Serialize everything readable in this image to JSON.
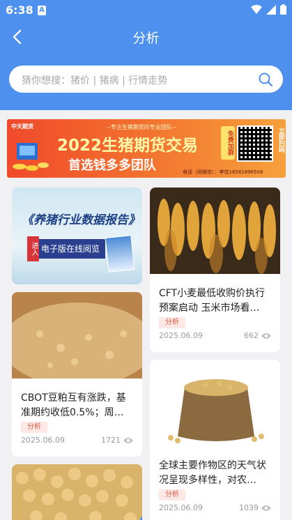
{
  "status_bar": {
    "time": "6:38",
    "notification_glyph": "A"
  },
  "header": {
    "title": "分析",
    "back_icon": "chevron-left-icon"
  },
  "search": {
    "placeholder": "猜你想搜：猪价 | 猪病 | 行情走势"
  },
  "banner": {
    "company": "中天期货",
    "tagline": "--专注生猪期货的专业团队--",
    "headline": "2022生猪期货交易",
    "subline": "首选钱多多团队",
    "free_label": "免费加群",
    "scan_label": "立即扫码",
    "contact": "电话（同微信）：李佳18581896508"
  },
  "ad_card": {
    "title": "《养猪行业数据报告》",
    "enter_label": "进入",
    "read_label": "电子版在线阅览"
  },
  "articles": [
    {
      "title": "CFT小麦最低收购价执行预案启动 玉米市场看…",
      "tag": "分析",
      "date": "2025.06.09",
      "views": "662"
    },
    {
      "title": "CBOT豆粕互有涨跌，基准期约收低0.5%；周…",
      "tag": "分析",
      "date": "2025.06.09",
      "views": "1721"
    },
    {
      "title": "全球主要作物区的天气状况呈现多样性，对农…",
      "tag": "分析",
      "date": "2025.06.09",
      "views": "1039"
    }
  ],
  "colors": {
    "header_blue": "#4d90ee",
    "tag_red": "#e25741",
    "page_bg": "#f1f1f3"
  }
}
